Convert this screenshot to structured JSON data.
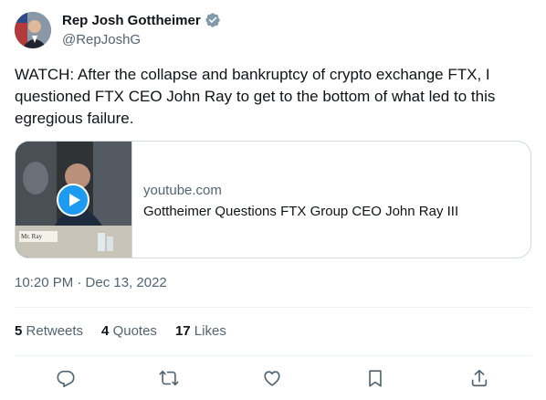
{
  "author": {
    "name": "Rep Josh Gottheimer",
    "handle": "@RepJoshG"
  },
  "tweet": {
    "text": "WATCH: After the collapse and bankruptcy of crypto exchange FTX, I questioned FTX CEO John Ray to get to the bottom of what led to this egregious failure.",
    "timestamp": "10:20 PM · Dec 13, 2022"
  },
  "card": {
    "domain": "youtube.com",
    "title": "Gottheimer Questions FTX Group CEO John Ray III",
    "placard_text": "Mr. Ray"
  },
  "stats": {
    "retweets_count": "5",
    "retweets_label": "Retweets",
    "quotes_count": "4",
    "quotes_label": "Quotes",
    "likes_count": "17",
    "likes_label": "Likes"
  },
  "icons": {
    "verified": "verified-badge-icon",
    "play": "play-icon",
    "reply": "reply-icon",
    "retweet": "retweet-icon",
    "like": "heart-icon",
    "bookmark": "bookmark-icon",
    "share": "share-icon"
  },
  "colors": {
    "text_primary": "#0f1419",
    "text_secondary": "#536471",
    "border": "#cfd9de",
    "play_blue": "#1d9bf0"
  }
}
